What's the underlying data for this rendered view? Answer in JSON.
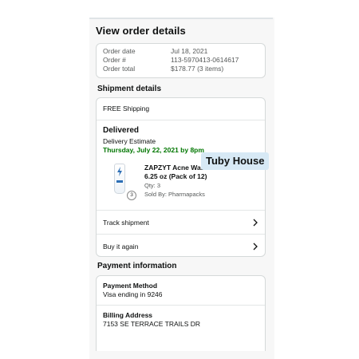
{
  "page_title": "View order details",
  "summary": {
    "rows": [
      {
        "label": "Order date",
        "value": "Jul 18, 2021"
      },
      {
        "label": "Order #",
        "value": "113-5970413-0614617"
      },
      {
        "label": "Order total",
        "value": "$178.77 (3 items)"
      }
    ]
  },
  "shipment": {
    "section_title": "Shipment details",
    "shipping_type": "FREE Shipping",
    "status": "Delivered",
    "estimate_label": "Delivery Estimate",
    "estimate_date": "Thursday, July 22, 2021 by 8pm",
    "product": {
      "name_line1": "ZAPZYT Acne Was",
      "name_line2": "6.25 oz (Pack of 12)",
      "qty": "Qty: 3",
      "seller": "Sold By: Pharmapacks",
      "qty_badge": "3"
    },
    "track_label": "Track shipment",
    "buy_again_label": "Buy it again"
  },
  "overlay_text": "Tuby House",
  "payment": {
    "section_title": "Payment information",
    "method_label": "Payment Method",
    "method_value": "Visa ending in 9246",
    "billing_label": "Billing Address",
    "billing_value": "7153 SE TERRACE TRAILS DR"
  },
  "colors": {
    "delivery_green": "#007600",
    "overlay_bg": "#d7e9f5",
    "brand_blue": "#2d6fb5"
  }
}
